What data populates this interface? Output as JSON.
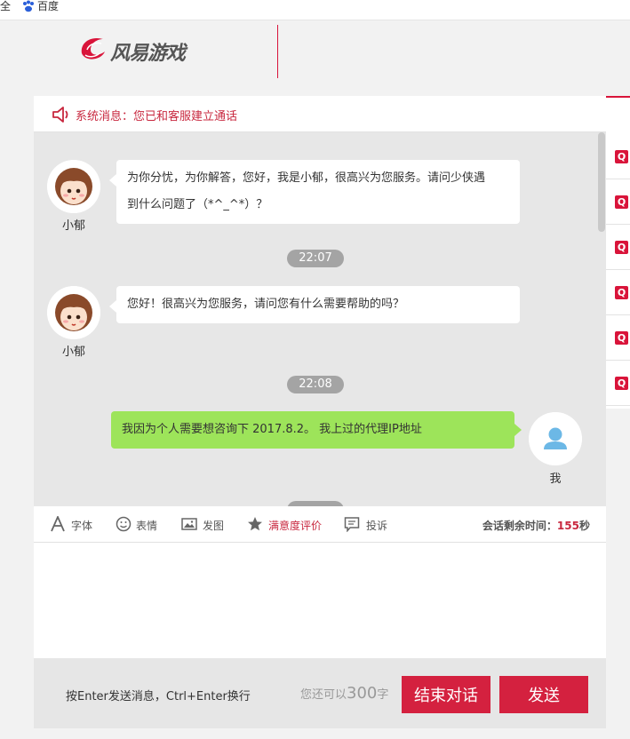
{
  "bookmarks": {
    "item1": "全",
    "item2": "百度"
  },
  "header": {
    "logo_text": "风易游戏"
  },
  "system": {
    "message": "系统消息：您已和客服建立通话"
  },
  "messages": [
    {
      "sender": "小郁",
      "text_line1": "为你分忧，为你解答，您好，我是小郁，很高兴为您服务。请问少侠遇",
      "text_line2": "到什么问题了（*^_^*）？"
    },
    {
      "time": "22:07"
    },
    {
      "sender": "小郁",
      "text": "您好！很高兴为您服务，请问您有什么需要帮助的吗？"
    },
    {
      "time": "22:08"
    },
    {
      "sender": "我",
      "text": "我因为个人需要想咨询下 2017.8.2。 我上过的代理IP地址"
    }
  ],
  "toolbar": {
    "font": "字体",
    "emoji": "表情",
    "image": "发图",
    "rating": "满意度评价",
    "complaint": "投诉",
    "timer_prefix": "会话剩余时间：",
    "timer_value": "155",
    "timer_unit": "秒"
  },
  "bottom": {
    "hint": "按Enter发送消息，Ctrl+Enter换行",
    "remain_prefix": "您还可以",
    "remain_count": "300",
    "remain_unit": "字",
    "end_label": "结束对话",
    "send_label": "发送"
  },
  "right_panel": {
    "badge": "Q"
  },
  "colors": {
    "accent": "#d4213f",
    "my_bubble": "#9de45a",
    "chat_bg": "#e7e7e7"
  }
}
